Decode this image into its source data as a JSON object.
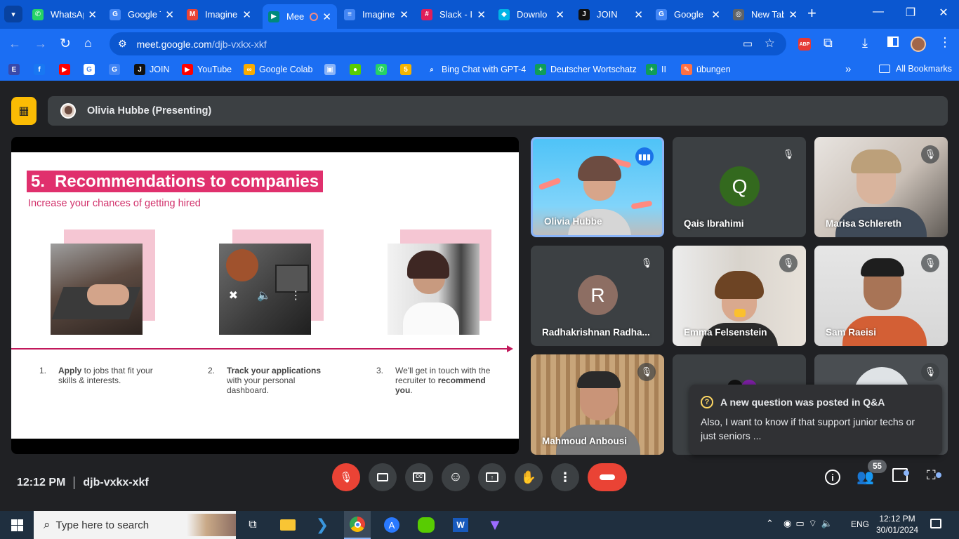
{
  "browser": {
    "tabs": [
      {
        "title": "WhatsApp",
        "icon": "whatsapp-icon",
        "color": "#25d366",
        "glyph": "✆"
      },
      {
        "title": "Google Translate",
        "icon": "google-translate-icon",
        "color": "#4285f4",
        "glyph": "G"
      },
      {
        "title": "Imagine",
        "icon": "gmail-icon",
        "color": "#ea4335",
        "glyph": "M"
      },
      {
        "title": "Mee",
        "icon": "google-meet-icon",
        "color": "#00897b",
        "glyph": "▶"
      },
      {
        "title": "Imagine",
        "icon": "google-docs-icon",
        "color": "#4285f4",
        "glyph": "≡"
      },
      {
        "title": "Slack - I",
        "icon": "slack-icon",
        "color": "#e01e5a",
        "glyph": "#"
      },
      {
        "title": "Downlo",
        "icon": "download-icon",
        "color": "#00b3e6",
        "glyph": "◆"
      },
      {
        "title": "JOIN",
        "icon": "join-icon",
        "color": "#111111",
        "glyph": "J"
      },
      {
        "title": "Google",
        "icon": "google-translate-icon",
        "color": "#4285f4",
        "glyph": "G"
      },
      {
        "title": "New Tab",
        "icon": "chrome-icon",
        "color": "#5f6368",
        "glyph": "◎"
      }
    ],
    "url_host": "meet.google.com",
    "url_path": "/djb-vxkx-xkf",
    "bookmarks": [
      {
        "label": "",
        "icon": "extension-bookmark-icon",
        "color": "#3949ab",
        "glyph": "E"
      },
      {
        "label": "",
        "icon": "facebook-icon",
        "color": "#1877f2",
        "glyph": "f"
      },
      {
        "label": "",
        "icon": "youtube-icon",
        "color": "#ff0000",
        "glyph": "▶"
      },
      {
        "label": "",
        "icon": "google-icon",
        "color": "#ffffff",
        "glyph": "G"
      },
      {
        "label": "",
        "icon": "google-translate-icon",
        "color": "#4285f4",
        "glyph": "G"
      },
      {
        "label": "JOIN",
        "icon": "join-icon",
        "color": "#111111",
        "glyph": "J"
      },
      {
        "label": "YouTube",
        "icon": "youtube-icon",
        "color": "#ff0000",
        "glyph": "▶"
      },
      {
        "label": "Google Colab",
        "icon": "colab-icon",
        "color": "#f9ab00",
        "glyph": "∞"
      },
      {
        "label": "",
        "icon": "image-bookmark-icon",
        "color": "#8ab4f8",
        "glyph": "▣"
      },
      {
        "label": "",
        "icon": "duolingo-icon",
        "color": "#58cc02",
        "glyph": "●"
      },
      {
        "label": "",
        "icon": "whatsapp-icon",
        "color": "#25d366",
        "glyph": "✆"
      },
      {
        "label": "",
        "icon": "five-icon",
        "color": "#f4b400",
        "glyph": "5"
      },
      {
        "label": "Bing Chat with GPT-4",
        "icon": "search-icon",
        "color": "#1b6ef3",
        "glyph": "⌕"
      },
      {
        "label": "Deutscher Wortschatz",
        "icon": "sheets-icon",
        "color": "#0f9d58",
        "glyph": "+"
      },
      {
        "label": "II",
        "icon": "sheets-icon",
        "color": "#0f9d58",
        "glyph": "+"
      },
      {
        "label": "übungen",
        "icon": "pen-icon",
        "color": "#ff7043",
        "glyph": "✎"
      }
    ],
    "all_bookmarks": "All Bookmarks",
    "abp_label": "ABP"
  },
  "meet": {
    "presenter": "Olivia Hubbe (Presenting)",
    "slide": {
      "number": "5.",
      "title": "Recommendations to companies",
      "subtitle": "Increase your chances of getting hired",
      "steps": [
        {
          "num": "1.",
          "bold": "Apply",
          "rest": " to jobs that fit your skills & interests."
        },
        {
          "num": "2.",
          "bold": "Track your applications",
          "rest": " with your personal dashboard."
        },
        {
          "num": "3.",
          "pre": "We'll get in touch with the recruiter to ",
          "bold": "recommend you",
          "rest": "."
        }
      ]
    },
    "participants": [
      {
        "name": "Olivia Hubbe",
        "speaking": true
      },
      {
        "name": "Qais Ibrahimi",
        "initial": "Q",
        "avatar_color": "#33691e"
      },
      {
        "name": "Marisa Schlereth"
      },
      {
        "name": "Radhakrishnan Radha...",
        "initial": "R",
        "avatar_color": "#8d6e63"
      },
      {
        "name": "Emma Felsenstein"
      },
      {
        "name": "Sam Raeisi"
      },
      {
        "name": "Mahmoud Anbousi"
      },
      {
        "name": ""
      },
      {
        "name": ""
      }
    ],
    "notification": {
      "title": "A new question was posted in Q&A",
      "body": "Also, I want to know if that support junior techs or just seniors ..."
    },
    "time": "12:12 PM",
    "meeting_code": "djb-vxkx-xkf",
    "participant_count": "55"
  },
  "taskbar": {
    "search_placeholder": "Type here to search",
    "language": "ENG",
    "clock_time": "12:12 PM",
    "clock_date": "30/01/2024"
  }
}
